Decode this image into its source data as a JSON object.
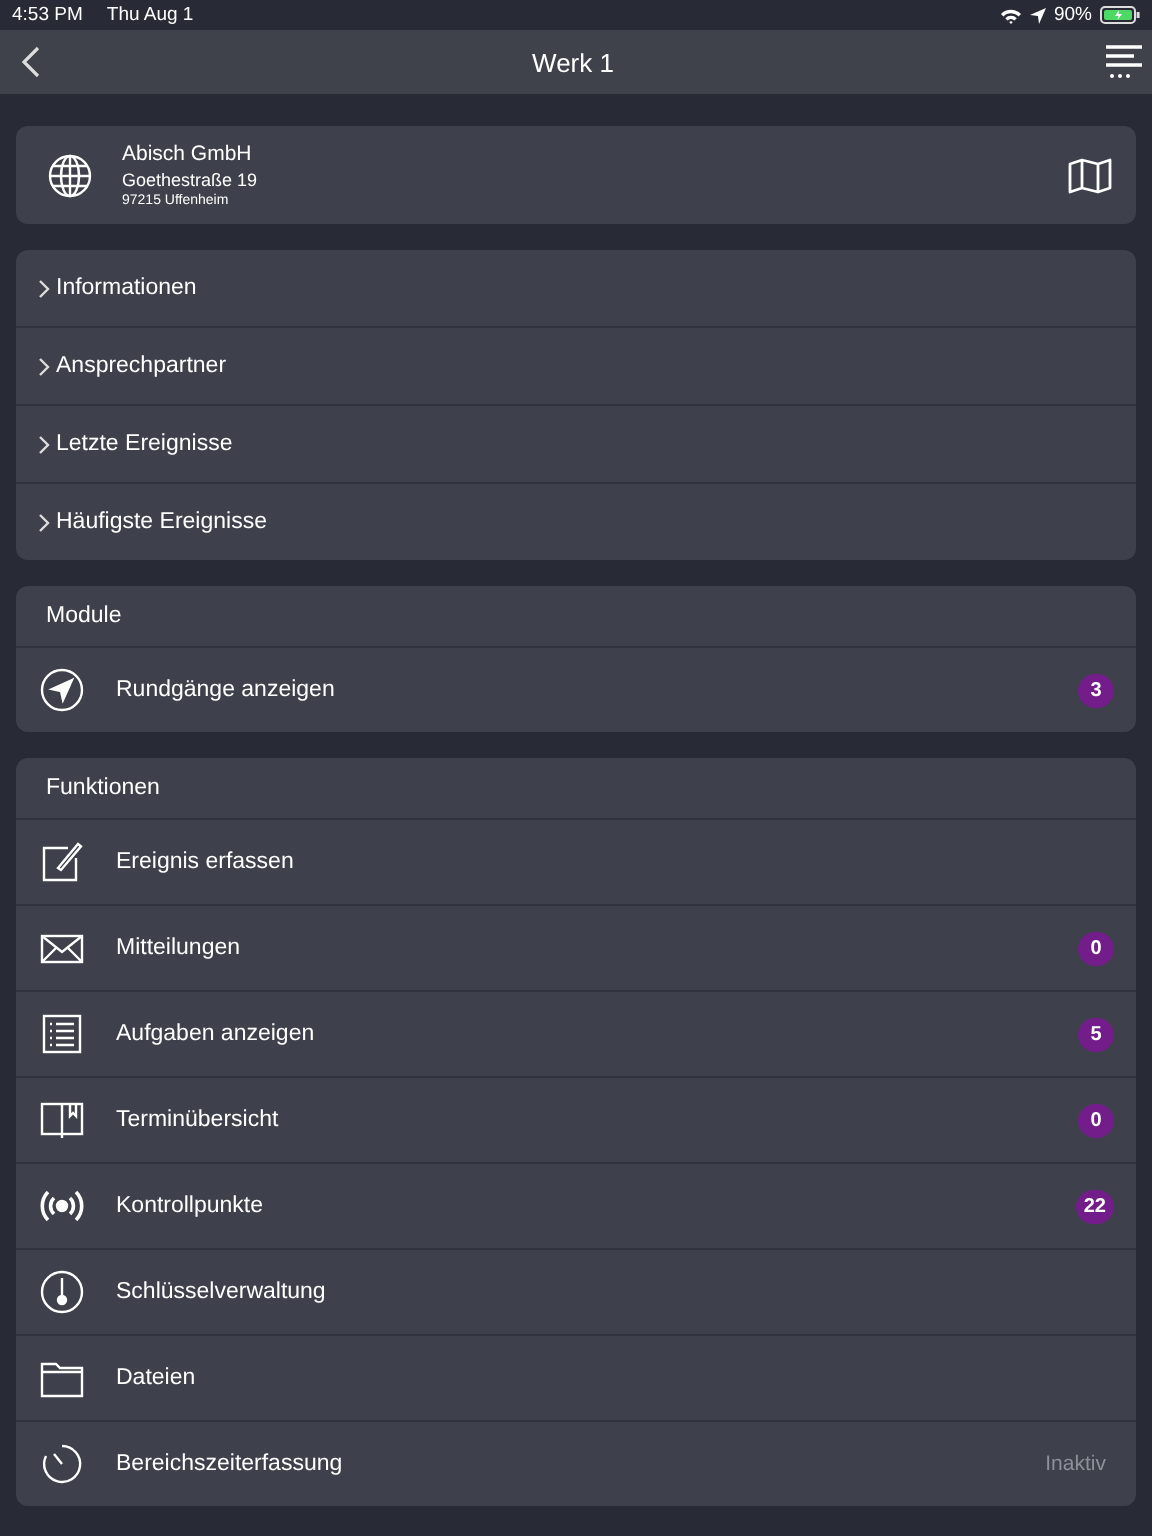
{
  "status_bar": {
    "time": "4:53 PM",
    "date": "Thu Aug 1",
    "battery": "90%"
  },
  "nav": {
    "title": "Werk 1"
  },
  "site": {
    "name": "Abisch GmbH",
    "street": "Goethestraße 19",
    "city": "97215 Uffenheim"
  },
  "sections": [
    {
      "label": "Informationen",
      "expanded": false
    },
    {
      "label": "Ansprechpartner",
      "expanded": false
    },
    {
      "label": "Letzte Ereignisse",
      "expanded": false
    },
    {
      "label": "Häufigste Ereignisse",
      "expanded": false
    }
  ],
  "groups": [
    {
      "title": "Module",
      "items": [
        {
          "label": "Rundgänge anzeigen",
          "badge": "3"
        }
      ]
    },
    {
      "title": "Funktionen",
      "items": [
        {
          "label": "Ereignis erfassen"
        },
        {
          "label": "Mitteilungen",
          "badge": "0"
        },
        {
          "label": "Aufgaben anzeigen",
          "badge": "5"
        },
        {
          "label": "Terminübersicht",
          "badge": "0"
        },
        {
          "label": "Kontrollpunkte",
          "badge": "22"
        },
        {
          "label": "Schlüsselverwaltung"
        },
        {
          "label": "Dateien"
        },
        {
          "label": "Bereichszeiterfassung",
          "status": "Inaktiv"
        }
      ]
    }
  ]
}
